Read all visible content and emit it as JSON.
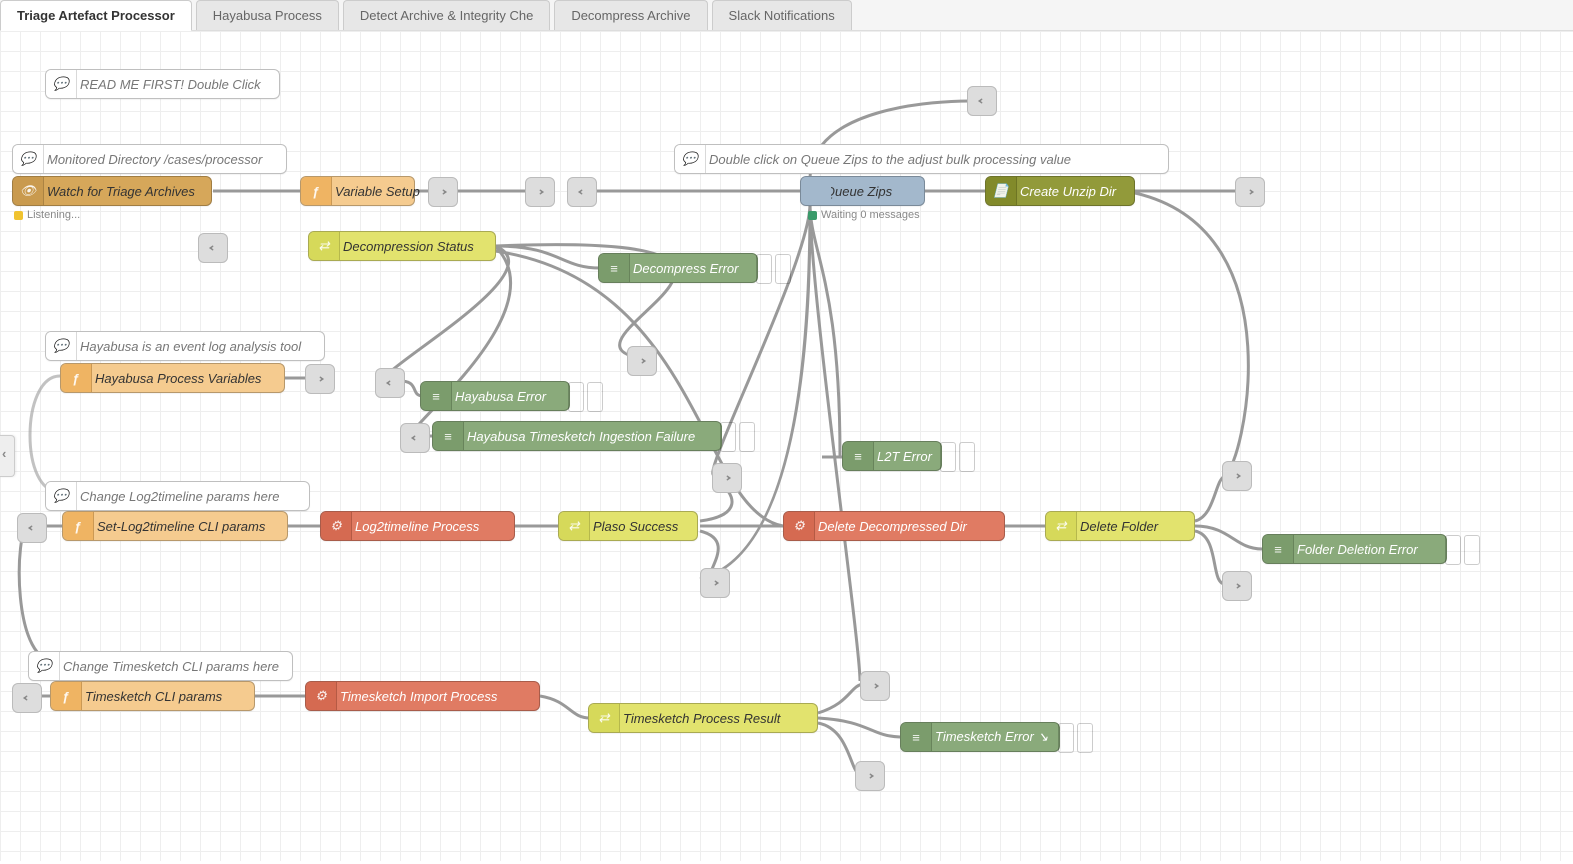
{
  "tabs": {
    "t0": "Triage Artefact Processor",
    "t1": "Hayabusa Process",
    "t2": "Detect Archive & Integrity Che",
    "t3": "Decompress Archive",
    "t4": "Slack Notifications"
  },
  "comments": {
    "readme": "READ ME FIRST! Double Click",
    "monitored": "Monitored Directory /cases/processor",
    "hayabusa_desc": "Hayabusa is an event log analysis tool",
    "l2t_params_hint": "Change Log2timeline params here",
    "ts_params_hint": "Change Timesketch CLI params here",
    "queue_hint": "Double click on Queue Zips to the adjust bulk processing value"
  },
  "nodes": {
    "watch": "Watch for Triage Archives",
    "var_setup": "Variable Setup",
    "queue_zips": "Queue Zips",
    "create_unzip": "Create Unzip Dir",
    "decomp_status": "Decompression Status",
    "decomp_error": "Decompress Error",
    "hayabusa_vars": "Hayabusa Process Variables",
    "hayabusa_error": "Hayabusa Error",
    "hayabusa_ts_fail": "Hayabusa Timesketch Ingestion Failure",
    "l2t_error": "L2T Error",
    "set_l2t": "Set-Log2timeline CLI params",
    "l2t_process": "Log2timeline Process",
    "plaso_success": "Plaso Success",
    "del_decompressed": "Delete Decompressed Dir",
    "del_folder": "Delete Folder",
    "folder_del_error": "Folder Deletion Error",
    "ts_params": "Timesketch CLI params",
    "ts_import": "Timesketch Import Process",
    "ts_result": "Timesketch Process Result",
    "ts_error": "Timesketch Error  ↘"
  },
  "status": {
    "listening": "Listening...",
    "queue": "Waiting 0 messages"
  },
  "icons": {
    "comment": "comment-icon",
    "eye": "eye-icon",
    "fn": "function-icon",
    "switch": "switch-icon",
    "debug": "debug-icon",
    "gear": "gear-icon",
    "file": "file-icon",
    "link": "link-icon"
  }
}
